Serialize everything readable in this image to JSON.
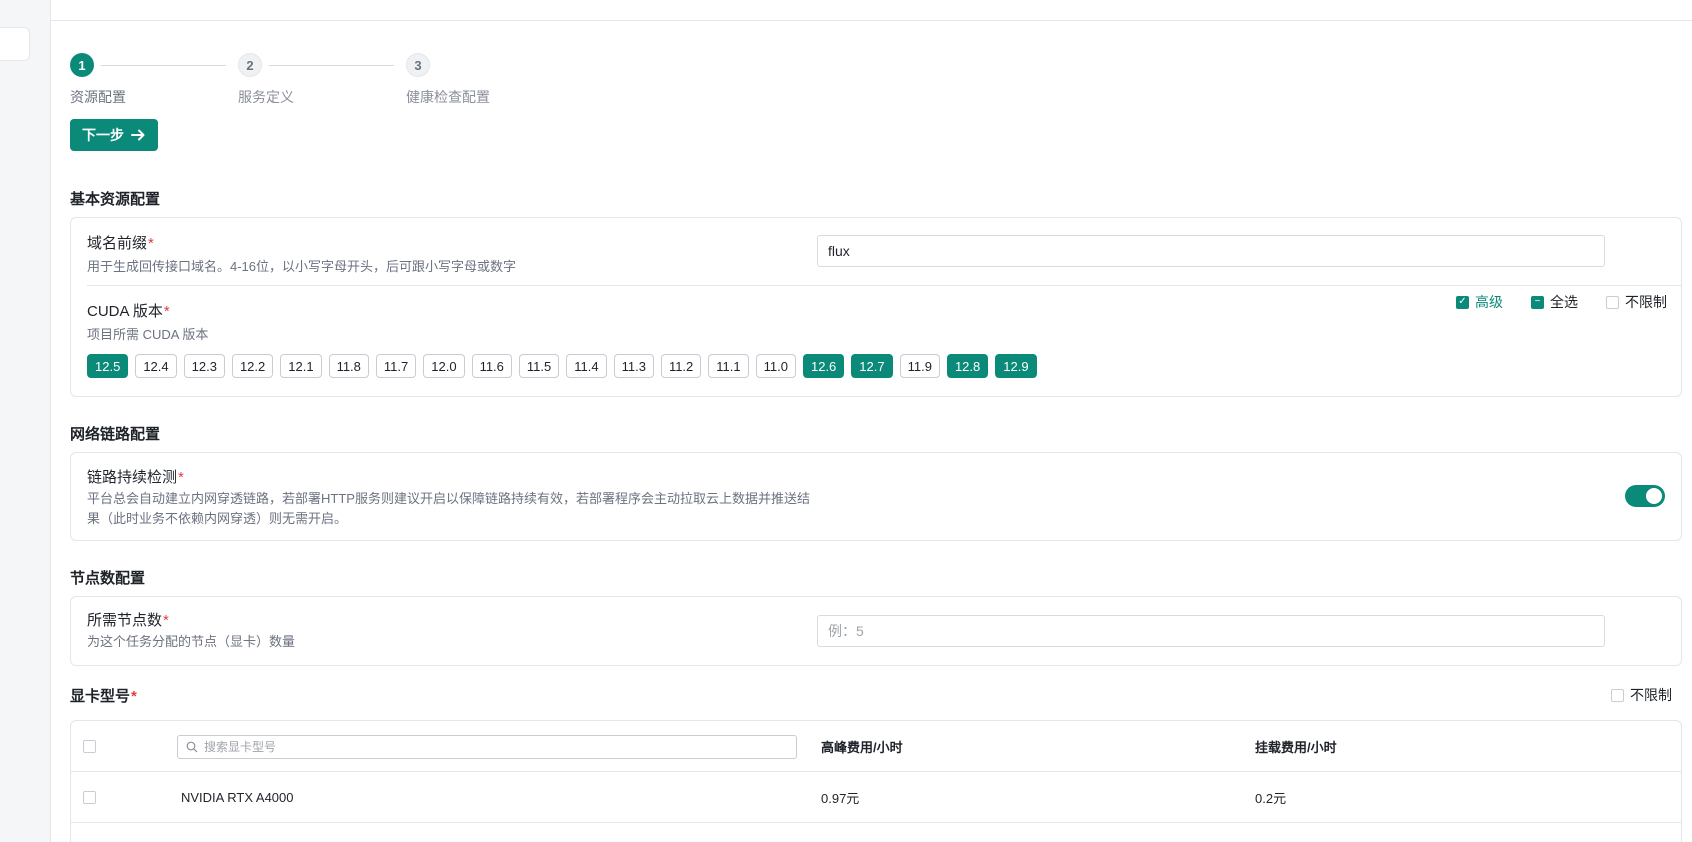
{
  "steps": [
    {
      "num": "1",
      "label": "资源配置"
    },
    {
      "num": "2",
      "label": "服务定义"
    },
    {
      "num": "3",
      "label": "健康检查配置"
    }
  ],
  "next_button": {
    "label": "下一步"
  },
  "basic": {
    "title": "基本资源配置",
    "domain": {
      "label": "域名前缀",
      "required": "*",
      "desc": "用于生成回传接口域名。4-16位，以小写字母开头，后可跟小写字母或数字",
      "value": "flux"
    },
    "cuda": {
      "label": "CUDA 版本",
      "required": "*",
      "desc": "项目所需 CUDA 版本",
      "options": {
        "advanced": "高级",
        "select_all": "全选",
        "no_limit": "不限制"
      },
      "versions": [
        {
          "v": "12.5",
          "on": true
        },
        {
          "v": "12.4",
          "on": false
        },
        {
          "v": "12.3",
          "on": false
        },
        {
          "v": "12.2",
          "on": false
        },
        {
          "v": "12.1",
          "on": false
        },
        {
          "v": "11.8",
          "on": false
        },
        {
          "v": "11.7",
          "on": false
        },
        {
          "v": "12.0",
          "on": false
        },
        {
          "v": "11.6",
          "on": false
        },
        {
          "v": "11.5",
          "on": false
        },
        {
          "v": "11.4",
          "on": false
        },
        {
          "v": "11.3",
          "on": false
        },
        {
          "v": "11.2",
          "on": false
        },
        {
          "v": "11.1",
          "on": false
        },
        {
          "v": "11.0",
          "on": false
        },
        {
          "v": "12.6",
          "on": true
        },
        {
          "v": "12.7",
          "on": true
        },
        {
          "v": "11.9",
          "on": false
        },
        {
          "v": "12.8",
          "on": true
        },
        {
          "v": "12.9",
          "on": true
        }
      ]
    }
  },
  "network": {
    "title": "网络链路配置",
    "persist": {
      "label": "链路持续检测",
      "required": "*",
      "desc_line1": "平台总会自动建立内网穿透链路，若部署HTTP服务则建议开启以保障链路持续有效，若部署程序会主动拉取云上数据并推送结",
      "desc_line2": "果（此时业务不依赖内网穿透）则无需开启。"
    }
  },
  "nodes": {
    "title": "节点数配置",
    "count": {
      "label": "所需节点数",
      "required": "*",
      "desc": "为这个任务分配的节点（显卡）数量",
      "placeholder": "例：5"
    }
  },
  "gpu": {
    "title": "显卡型号",
    "required": "*",
    "no_limit": "不限制",
    "search_placeholder": "搜索显卡型号",
    "columns": {
      "peak": "高峰费用/小时",
      "mount": "挂载费用/小时"
    },
    "rows": [
      {
        "name": "NVIDIA RTX A4000",
        "peak": "0.97元",
        "mount": "0.2元"
      }
    ]
  }
}
